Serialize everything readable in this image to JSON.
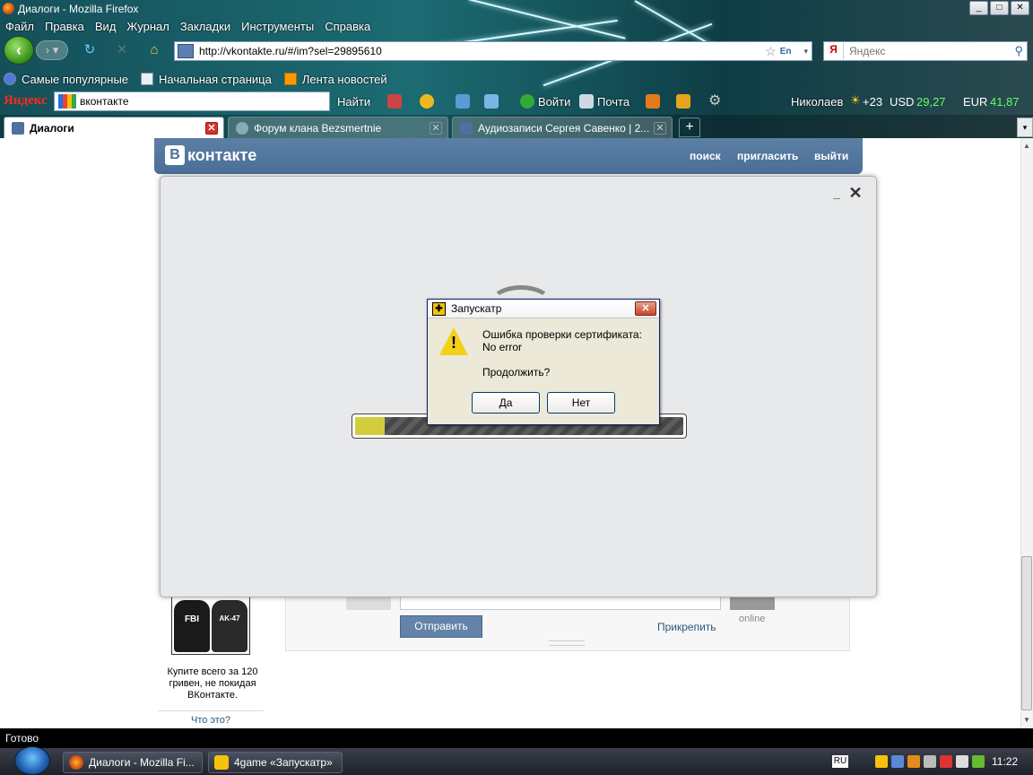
{
  "window": {
    "title": "Диалоги - Mozilla Firefox",
    "btn_min": "_",
    "btn_max": "□",
    "btn_close": "✕"
  },
  "menu": [
    "Файл",
    "Правка",
    "Вид",
    "Журнал",
    "Закладки",
    "Инструменты",
    "Справка"
  ],
  "nav": {
    "url": "http://vkontakte.ru/#/im?sel=29895610",
    "search_placeholder": "Яндекс",
    "lang_badge": "En",
    "search_engine": "Я"
  },
  "bookmarks": [
    "Самые популярные",
    "Начальная страница",
    "Лента новостей"
  ],
  "yandex_bar": {
    "logo": "Яндекс",
    "query": "вконтакте",
    "find": "Найти",
    "login": "Войти",
    "mail": "Почта",
    "user": "Николаев",
    "weather": "+23",
    "usd_label": "USD",
    "usd_value": "29,27",
    "eur_label": "EUR",
    "eur_value": "41,87"
  },
  "tabs": [
    {
      "label": "Диалоги",
      "active": true
    },
    {
      "label": "Форум клана Bezsmertnie",
      "active": false
    },
    {
      "label": "Аудиозаписи Сергея Савенко | 2...",
      "active": false
    }
  ],
  "vk": {
    "logo_letter": "В",
    "logo_text": "контакте",
    "nav": [
      "поиск",
      "пригласить",
      "выйти"
    ],
    "ad": {
      "text": "Купите всего за 120 гривен, не покидая ВКонтакте.",
      "link": "Что это?",
      "shirt1": "FBI",
      "shirt2": "AK-47"
    },
    "compose": {
      "send": "Отправить",
      "attach": "Прикрепить",
      "status": "online"
    }
  },
  "launcher": {
    "progress": 0.09
  },
  "dialog": {
    "title": "Запускатр",
    "message_line1": "Ошибка проверки сертификата:",
    "message_line2": "No error",
    "question": "Продолжить?",
    "yes": "Да",
    "no": "Нет"
  },
  "status": "Готово",
  "taskbar": {
    "items": [
      "Диалоги - Mozilla Fi...",
      "4game «Запускатр»"
    ],
    "lang": "RU",
    "clock": "11:22"
  },
  "colors": {
    "vk_blue": "#4a6f98",
    "progress_fill": "#d2cd3c",
    "dialog_bg": "#ece9d8"
  }
}
